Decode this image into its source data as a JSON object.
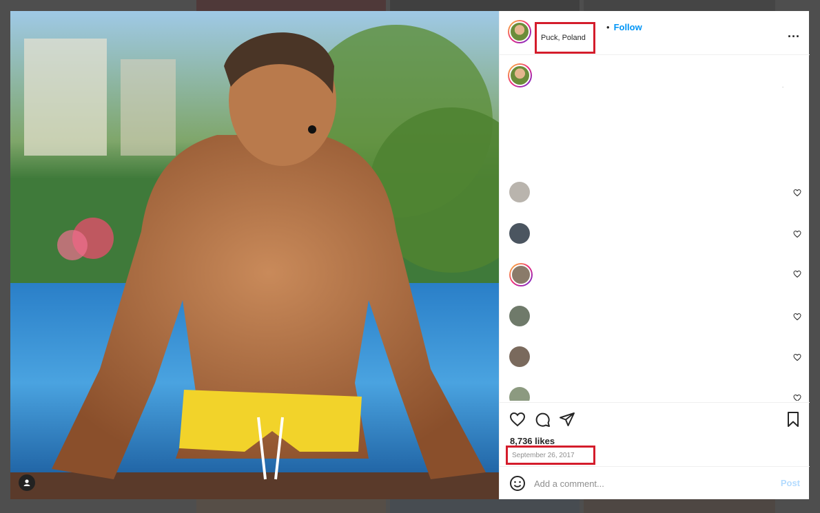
{
  "post": {
    "location": "Puck, Poland",
    "follow_label": "Follow",
    "follow_dot": "•",
    "more_label": "...",
    "caption_trailing": ".",
    "likes": "8,736 likes",
    "date": "September 26, 2017",
    "comment_placeholder": "Add a comment...",
    "post_label": "Post"
  },
  "comments": [
    {
      "avatar_color": "#b9b4ad"
    },
    {
      "avatar_color": "#4b5560"
    },
    {
      "avatar_color": "#8a7b6a"
    },
    {
      "avatar_color": "#6f7a6a"
    },
    {
      "avatar_color": "#7a6a5d"
    },
    {
      "avatar_color": "#8c9a80"
    }
  ],
  "colors": {
    "highlight": "#d41c2b",
    "link": "#0095f6",
    "post_disabled": "#b3dbff"
  },
  "icons": {
    "like": "heart-icon",
    "comment": "comment-icon",
    "share": "paper-plane-icon",
    "save": "bookmark-icon",
    "emoji": "smiley-icon",
    "more": "more-icon",
    "user_tag": "user-icon"
  }
}
